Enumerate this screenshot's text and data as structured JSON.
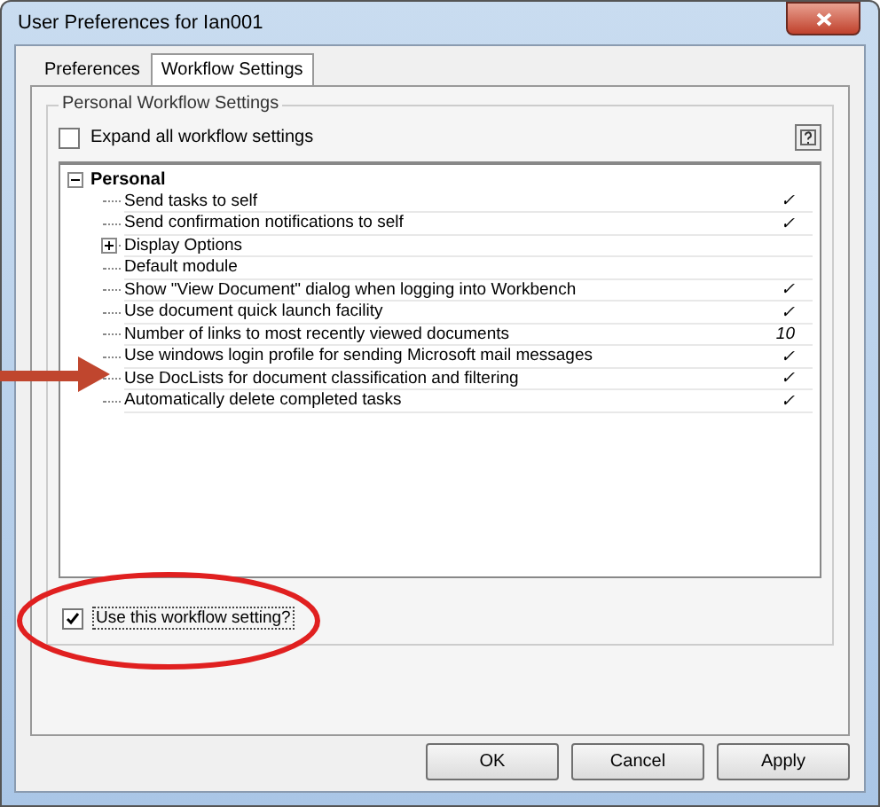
{
  "window": {
    "title": "User Preferences for Ian001"
  },
  "tabs": [
    {
      "label": "Preferences",
      "selected": false
    },
    {
      "label": "Workflow Settings",
      "selected": true
    }
  ],
  "group": {
    "title": "Personal Workflow Settings",
    "expand_all": {
      "label": "Expand all workflow settings",
      "checked": false
    }
  },
  "tree": {
    "label": "Personal",
    "expanded": true,
    "children": [
      {
        "label": "Send tasks to self",
        "value": "✓"
      },
      {
        "label": "Send confirmation notifications to self",
        "value": "✓"
      },
      {
        "label": "Display Options",
        "expanded": false
      },
      {
        "label": "Default module"
      },
      {
        "label": "Show \"View Document\" dialog when logging into Workbench",
        "value": "✓"
      },
      {
        "label": "Use document quick launch facility",
        "value": "✓"
      },
      {
        "label": "Number of links to most recently viewed documents",
        "value": "10"
      },
      {
        "label": "Use windows login profile for sending Microsoft mail messages",
        "value": "✓"
      },
      {
        "label": "Use DocLists for document classification and filtering",
        "value": "✓",
        "arrow": true
      },
      {
        "label": "Automatically delete completed tasks",
        "value": "✓"
      }
    ]
  },
  "use_setting": {
    "label": "Use this workflow setting?",
    "checked": true,
    "circled": true
  },
  "buttons": [
    "OK",
    "Cancel",
    "Apply"
  ]
}
